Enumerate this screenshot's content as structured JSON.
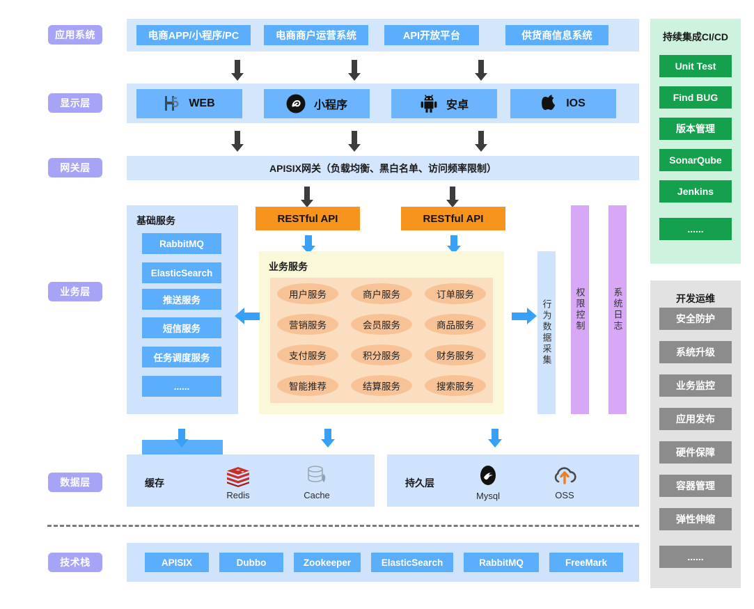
{
  "layers": [
    {
      "id": "app-system",
      "label": "应用系统"
    },
    {
      "id": "display",
      "label": "显示层"
    },
    {
      "id": "gateway",
      "label": "网关层"
    },
    {
      "id": "business",
      "label": "业务层"
    },
    {
      "id": "data",
      "label": "数据层"
    },
    {
      "id": "tech-stack",
      "label": "技术栈"
    }
  ],
  "app_systems": [
    {
      "label": "电商APP/小程序/PC"
    },
    {
      "label": "电商商户运营系统"
    },
    {
      "label": "API开放平台"
    },
    {
      "label": "供货商信息系统"
    }
  ],
  "display_layer": [
    {
      "label": "WEB",
      "icon": "h5-icon"
    },
    {
      "label": "小程序",
      "icon": "wechat-miniprogram-icon"
    },
    {
      "label": "安卓",
      "icon": "android-icon"
    },
    {
      "label": "IOS",
      "icon": "apple-icon"
    }
  ],
  "gateway": {
    "label": "APISIX网关（负载均衡、黑白名单、访问频率限制）"
  },
  "basic_services": {
    "title": "基础服务",
    "items": [
      {
        "label": "RabbitMQ"
      },
      {
        "label": "ElasticSearch"
      },
      {
        "label": "推送服务"
      },
      {
        "label": "短信服务"
      },
      {
        "label": "任务调度服务"
      },
      {
        "label": "......"
      }
    ]
  },
  "rest_apis": [
    {
      "label": "RESTful API"
    },
    {
      "label": "RESTful API"
    }
  ],
  "business_services": {
    "title": "业务服务",
    "items": [
      {
        "label": "用户服务"
      },
      {
        "label": "商户服务"
      },
      {
        "label": "订单服务"
      },
      {
        "label": "营销服务"
      },
      {
        "label": "会员服务"
      },
      {
        "label": "商品服务"
      },
      {
        "label": "支付服务"
      },
      {
        "label": "积分服务"
      },
      {
        "label": "财务服务"
      },
      {
        "label": "智能推荐"
      },
      {
        "label": "结算服务"
      },
      {
        "label": "搜索服务"
      }
    ]
  },
  "side_columns": [
    {
      "label": "行为数据采集",
      "color": "#cfe4fc"
    },
    {
      "label": "权限控制",
      "color": "#d7a8f5"
    },
    {
      "label": "系统日志",
      "color": "#d7a8f5"
    }
  ],
  "data_layer": {
    "cache": {
      "title": "缓存",
      "items": [
        {
          "label": "Redis",
          "icon": "redis-icon"
        },
        {
          "label": "Cache",
          "icon": "database-cache-icon"
        }
      ]
    },
    "persistence": {
      "title": "持久层",
      "items": [
        {
          "label": "Mysql",
          "icon": "mysql-icon"
        },
        {
          "label": "OSS",
          "icon": "oss-cloud-icon"
        }
      ]
    }
  },
  "tech_stack": [
    {
      "label": "APISIX"
    },
    {
      "label": "Dubbo"
    },
    {
      "label": "Zookeeper"
    },
    {
      "label": "ElasticSearch"
    },
    {
      "label": "RabbitMQ"
    },
    {
      "label": "FreeMark"
    }
  ],
  "cicd": {
    "title": "持续集成CI/CD",
    "items": [
      {
        "label": "Unit Test"
      },
      {
        "label": "Find BUG"
      },
      {
        "label": "版本管理"
      },
      {
        "label": "SonarQube"
      },
      {
        "label": "Jenkins"
      },
      {
        "label": "......"
      }
    ]
  },
  "devops": {
    "title": "开发运维",
    "items": [
      {
        "label": "安全防护"
      },
      {
        "label": "系统升级"
      },
      {
        "label": "业务监控"
      },
      {
        "label": "应用发布"
      },
      {
        "label": "硬件保障"
      },
      {
        "label": "容器管理"
      },
      {
        "label": "弹性伸缩"
      },
      {
        "label": "......"
      }
    ]
  },
  "colors": {
    "layer_badge": "#a7a3f7",
    "panel_light_blue": "#cfe4fc",
    "box_blue": "#5aaefc",
    "rest_orange": "#f7941e",
    "biz_panel_yellow": "#fbf8da",
    "biz_inner_peach": "#fbddc0",
    "service_pill": "#f7c396",
    "purple_column": "#d7a8f5",
    "cicd_panel": "#cdf2dd",
    "cicd_item": "#14a04c",
    "ops_panel": "#e2e2e2",
    "ops_item": "#8c8c8c",
    "arrow_blue": "#38a1f7",
    "arrow_dark": "#3c3c3c"
  }
}
